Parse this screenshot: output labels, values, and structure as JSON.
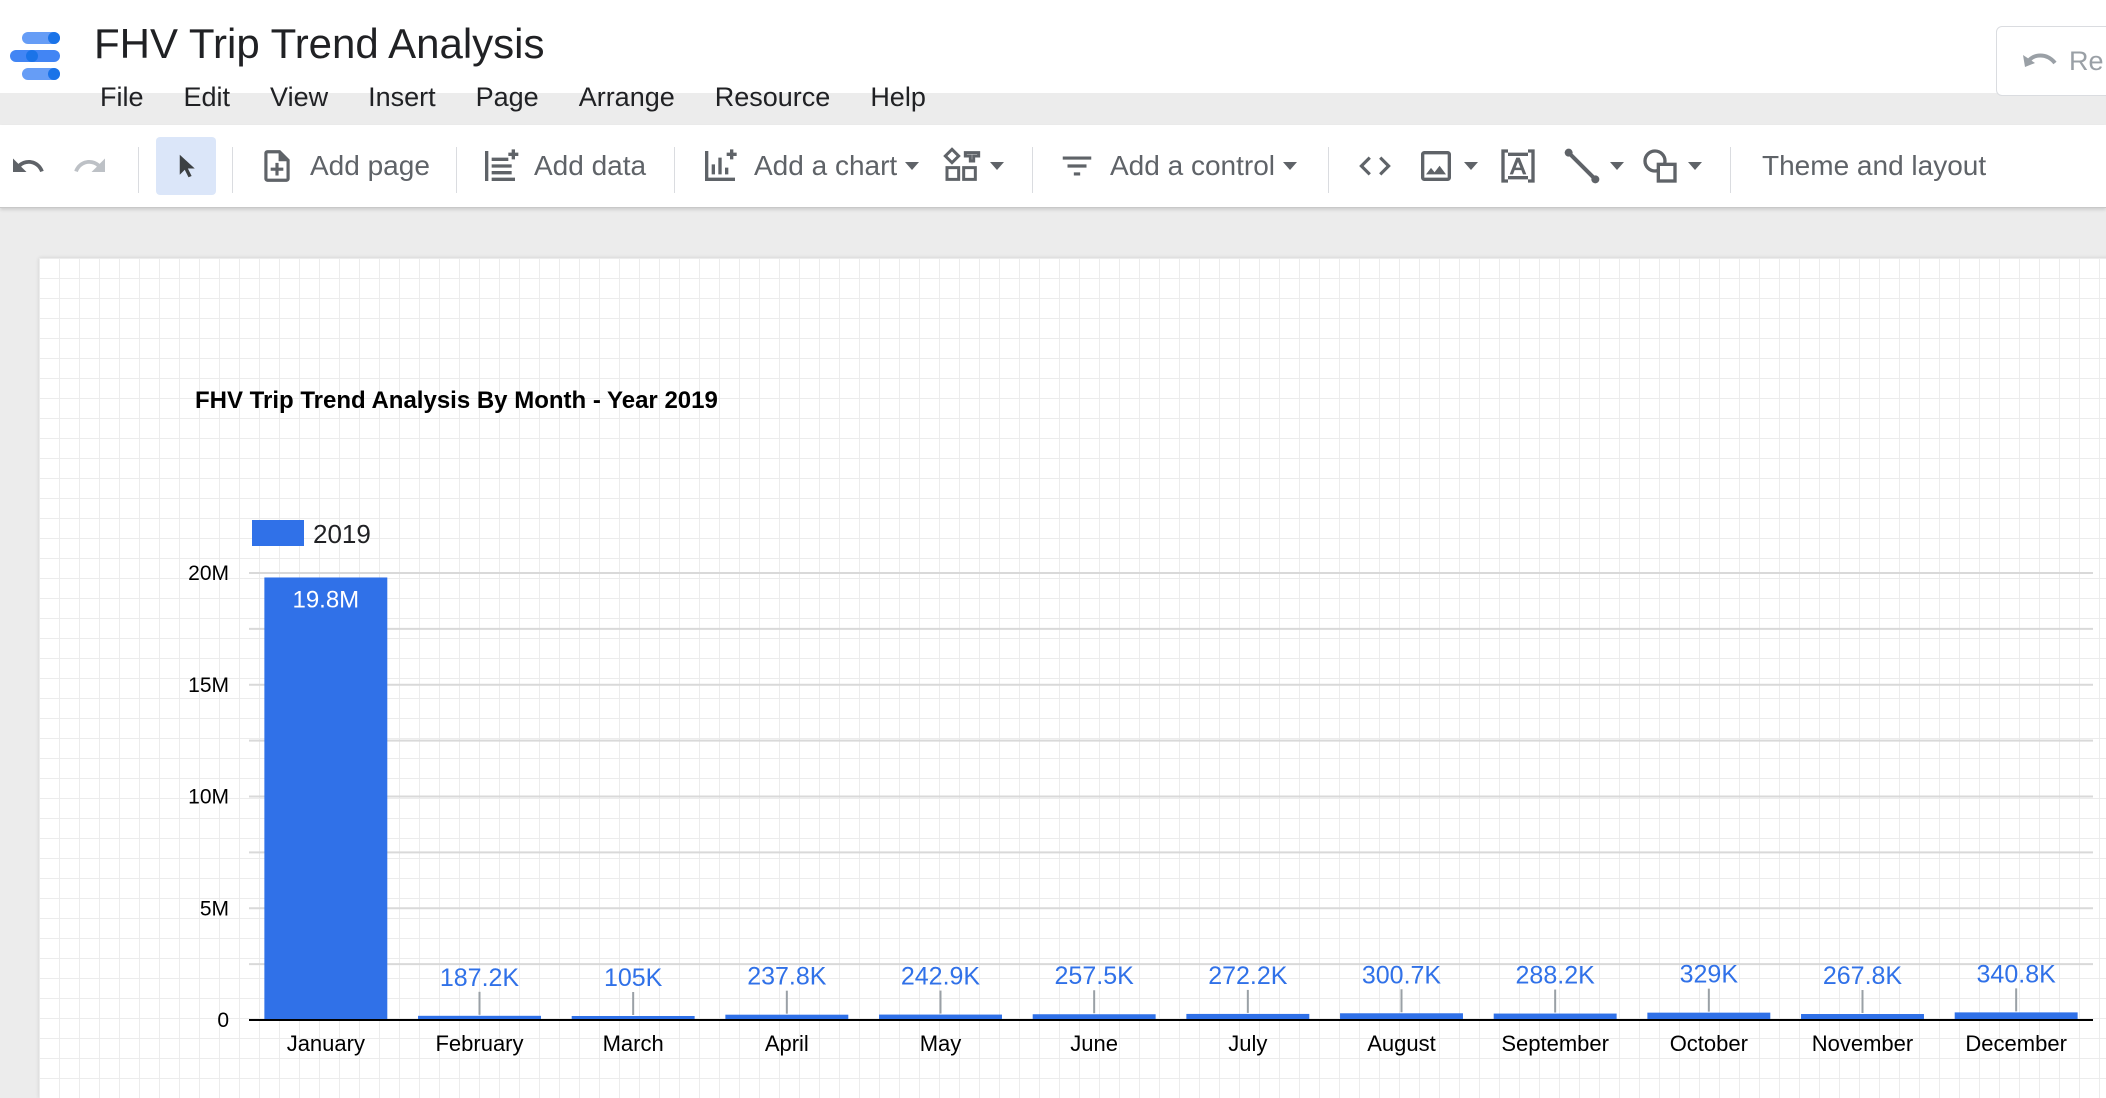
{
  "app": {
    "title": "FHV Trip Trend Analysis",
    "reset_label": "Re"
  },
  "menu": [
    "File",
    "Edit",
    "View",
    "Insert",
    "Page",
    "Arrange",
    "Resource",
    "Help"
  ],
  "toolbar": {
    "add_page": "Add page",
    "add_data": "Add data",
    "add_chart": "Add a chart",
    "add_control": "Add a control",
    "theme": "Theme and layout"
  },
  "colors": {
    "bar": "#3071e8",
    "accent": "#4285f4"
  },
  "icons": [
    "undo-icon",
    "redo-icon",
    "cursor-icon",
    "add-page-icon",
    "add-data-icon",
    "add-chart-icon",
    "community-viz-icon",
    "filter-control-icon",
    "embed-code-icon",
    "image-icon",
    "text-box-icon",
    "line-icon",
    "shape-icon"
  ],
  "chart_data": {
    "type": "bar",
    "title": "FHV Trip Trend Analysis By Month - Year 2019",
    "legend": [
      "2019"
    ],
    "legend_position": "top-left",
    "categories": [
      "January",
      "February",
      "March",
      "April",
      "May",
      "June",
      "July",
      "August",
      "September",
      "October",
      "November",
      "December"
    ],
    "series": [
      {
        "name": "2019",
        "values": [
          19800000,
          187200,
          105000,
          237800,
          242900,
          257500,
          272200,
          300700,
          288200,
          329000,
          267800,
          340800
        ],
        "labels": [
          "19.8M",
          "187.2K",
          "105K",
          "237.8K",
          "242.9K",
          "257.5K",
          "272.2K",
          "300.7K",
          "288.2K",
          "329K",
          "267.8K",
          "340.8K"
        ]
      }
    ],
    "yticks": [
      0,
      5000000,
      10000000,
      15000000,
      20000000
    ],
    "ytick_labels": [
      "0",
      "5M",
      "10M",
      "15M",
      "20M"
    ],
    "ylim": [
      0,
      20000000
    ],
    "grid": true
  }
}
